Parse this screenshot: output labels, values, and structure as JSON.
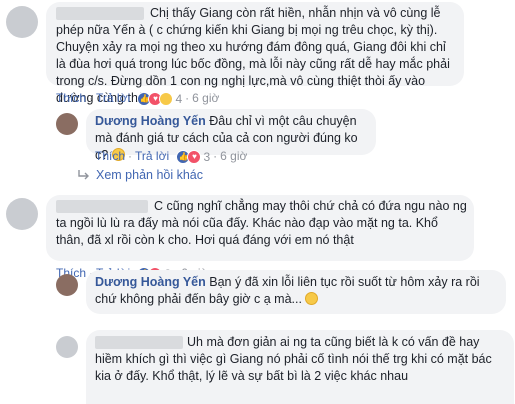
{
  "comments": [
    {
      "text": "Chị thấy Giang còn rất hiền, nhẫn nhịn và vô cùng lễ phép nữa Yến à ( c chứng kiến khi Giang bị mọi ng trêu chọc, kỳ thị). Chuyện xảy ra mọi ng theo xu hướng đám đông quá, Giang đôi khi chỉ là đùa hơi quá trong lúc bốc đồng, mà lỗi này cũng rất dễ hay mắc phải trong c/s. Đừng dồn 1 con ng nghị lực,mà vô cùng thiệt thòi ấy vào đường cùng thế chứ",
      "actions": {
        "like": "Thích",
        "reply": "Trả lời",
        "reactions": "4",
        "time": "6 giờ"
      },
      "replies": [
        {
          "author": "Dương Hoàng Yến",
          "text": "Đâu chỉ vì một câu chuyện mà đánh giá tư cách của cả con người đúng ko c?",
          "actions": {
            "like": "Thích",
            "reply": "Trả lời",
            "reactions": "3",
            "time": "6 giờ"
          }
        }
      ],
      "more_replies": "Xem phản hồi khác"
    },
    {
      "text": "C cũng nghĩ chẳng may thôi chứ chả có đứa ngu nào ng ta ngồi lù lù ra đấy mà nói cũa đấy. Khác nào đạp vào mặt ng ta. Khổ thân, đã xl rồi còn k cho. Hơi quá đáng với em nó thật",
      "actions": {
        "like": "Thích",
        "reply": "Trả lời",
        "reactions": "3",
        "time": "6 giờ"
      },
      "replies": [
        {
          "author": "Dương Hoàng Yến",
          "text": "Bạn ý đã xin lỗi liên tục rồi suốt từ hôm xảy ra rồi chứ không phải đến bây giờ c ạ mà...",
          "actions": {}
        },
        {
          "text": "Uh mà đơn giản ai ng ta cũng biết là k có vấn đề hay hiềm khích gì thì việc gì Giang nó phải cố tình nói thế trg khi có mặt bác kia ở đấy. Khổ thật, lý lẽ và sự bất bì là 2 việc khác nhau",
          "actions": {}
        }
      ]
    }
  ],
  "colors": {
    "link": "#4267b2",
    "name": "#365899",
    "bubble": "#f2f3f5",
    "meta": "#90949c"
  }
}
